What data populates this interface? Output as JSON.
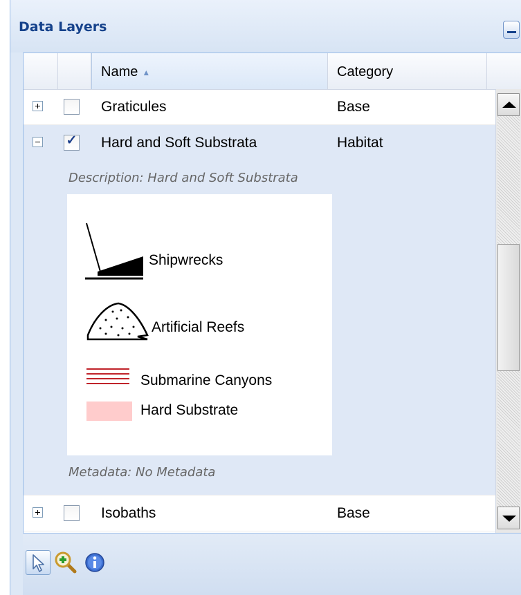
{
  "panel": {
    "title": "Data Layers"
  },
  "grid": {
    "columns": [
      {
        "label": "Name",
        "sorted": "ascending"
      },
      {
        "label": "Category"
      }
    ],
    "rows": [
      {
        "name": "Graticules",
        "category": "Base",
        "checked": false,
        "expanded": false
      },
      {
        "name": "Hard and Soft Substrata",
        "category": "Habitat",
        "checked": true,
        "expanded": true
      },
      {
        "name": "Isobaths",
        "category": "Base",
        "checked": false,
        "expanded": false
      }
    ],
    "expanded_detail": {
      "description": "Description: Hard and Soft Substrata",
      "legend": [
        {
          "label": "Shipwrecks",
          "icon": "shipwreck-icon"
        },
        {
          "label": "Artificial Reefs",
          "icon": "artificial-reef-icon"
        },
        {
          "label": "Submarine Canyons",
          "icon": "submarine-canyon-lines",
          "color": "#c0232a"
        },
        {
          "label": "Hard Substrate",
          "icon": "hard-substrate-swatch",
          "color": "#ffcccc"
        }
      ],
      "metadata": "Metadata: No Metadata"
    }
  },
  "toolbar": {
    "tools": [
      {
        "icon": "pointer-icon",
        "active": true
      },
      {
        "icon": "zoom-in-icon",
        "active": false
      },
      {
        "icon": "info-icon",
        "active": false
      }
    ]
  },
  "colors": {
    "header_text": "#15428b",
    "selected_row": "#dfe8f6",
    "panel_bg": "#dde8f6"
  }
}
